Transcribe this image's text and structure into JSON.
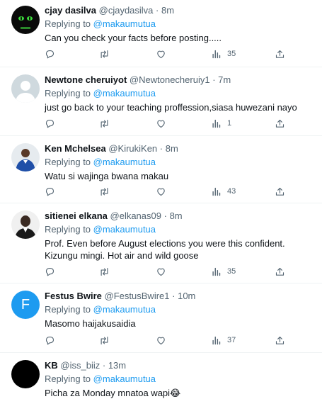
{
  "replying_label": "Replying to",
  "tweets": [
    {
      "name": "cjay dasilva",
      "handle": "@cjaydasilva",
      "time": "8m",
      "reply_to": "@makaumutua",
      "text": "Can you check your facts before posting.....",
      "views": "35",
      "avatar": "dark-cat-avatar"
    },
    {
      "name": "Newtone cheruiyot",
      "handle": "@Newtonecheruiy1",
      "time": "7m",
      "reply_to": "@makaumutua",
      "text": "just go back to your teaching proffession,siasa huwezani nayo",
      "views": "1",
      "avatar": "default-avatar"
    },
    {
      "name": "Ken Mchelsea",
      "handle": "@KirukiKen",
      "time": "8m",
      "reply_to": "@makaumutua",
      "text": "Watu si wajinga bwana makau",
      "views": "43",
      "avatar": "footballer-avatar"
    },
    {
      "name": "sitienei elkana",
      "handle": "@elkanas09",
      "time": "8m",
      "reply_to": "@makaumutua",
      "text": "Prof. Even before August elections you were this confident. Kizungu mingi. Hot air and wild goose",
      "views": "35",
      "avatar": "portrait-avatar"
    },
    {
      "name": "Festus Bwire",
      "handle": "@FestusBwire1",
      "time": "10m",
      "reply_to": "@makaumutua",
      "text": "Masomo haijakusaidia",
      "views": "37",
      "avatar": "letter-avatar",
      "avatar_letter": "F"
    },
    {
      "name": "KB",
      "handle": "@iss_biiz",
      "time": "13m",
      "reply_to": "@makaumutua",
      "text": "Picha za Monday mnatoa wapi😂",
      "views": "",
      "avatar": "black-avatar"
    }
  ],
  "colors": {
    "link": "#1d9bf0",
    "muted": "#536471",
    "text": "#0f1419",
    "festus_avatar": "#1d9bf0"
  }
}
